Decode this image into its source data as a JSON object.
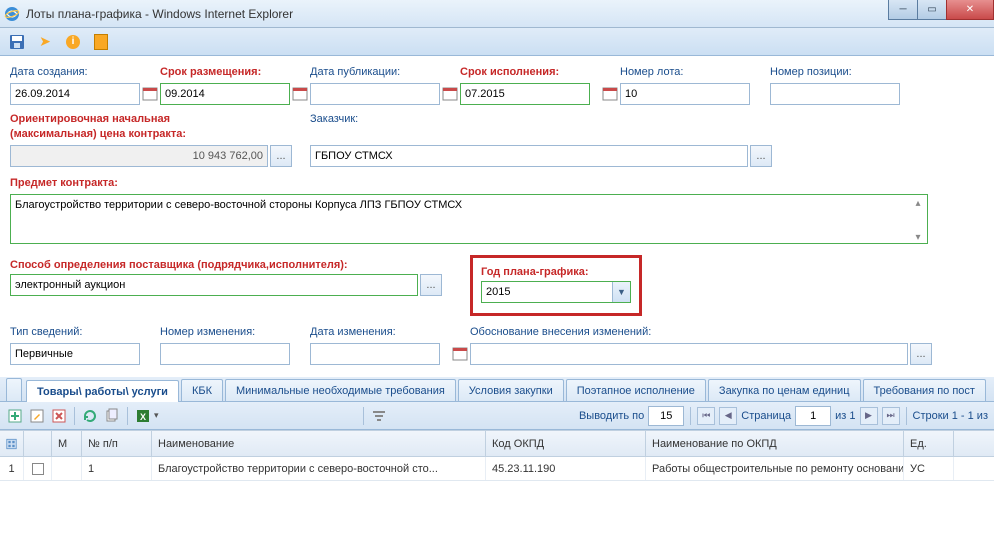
{
  "window": {
    "title": "Лоты плана-графика - Windows Internet Explorer"
  },
  "labels": {
    "createDate": "Дата создания:",
    "placementDate": "Срок размещения:",
    "publishDate": "Дата публикации:",
    "execDate": "Срок исполнения:",
    "lotNumber": "Номер лота:",
    "posNumber": "Номер позиции:",
    "priceLabel1": "Ориентировочная начальная",
    "priceLabel2": "(максимальная) цена контракта:",
    "customer": "Заказчик:",
    "subject": "Предмет контракта:",
    "method": "Способ определения поставщика (подрядчика,исполнителя):",
    "planYear": "Год плана-графика:",
    "infoType": "Тип сведений:",
    "changeNumber": "Номер изменения:",
    "changeDate": "Дата изменения:",
    "changeReason": "Обоснование внесения изменений:"
  },
  "values": {
    "createDate": "26.09.2014",
    "placementDate": "09.2014",
    "publishDate": "",
    "execDate": "07.2015",
    "lotNumber": "10",
    "posNumber": "",
    "price": "10 943 762,00",
    "customer": "ГБПОУ СТМСХ",
    "subject": "Благоустройство территории с северо-восточной стороны Корпуса ЛПЗ ГБПОУ СТМСХ",
    "method": "электронный аукцион",
    "planYear": "2015",
    "infoType": "Первичные",
    "changeNumber": "",
    "changeDate": "",
    "changeReason": ""
  },
  "tabs": [
    "Товары\\ работы\\ услуги",
    "КБК",
    "Минимальные необходимые требования",
    "Условия закупки",
    "Поэтапное исполнение",
    "Закупка по ценам единиц",
    "Требования по пост"
  ],
  "gridToolbar": {
    "perPageLabel": "Выводить по",
    "perPage": "15",
    "pageLabel": "Страница",
    "page": "1",
    "ofLabel": "из 1",
    "rowsLabel": "Строки 1 - 1 из"
  },
  "gridHeaders": {
    "m": "М",
    "np": "№ п/п",
    "name": "Наименование",
    "okpd": "Код ОКПД",
    "okpdName": "Наименование по ОКПД",
    "ed": "Ед."
  },
  "gridRows": [
    {
      "idx": "1",
      "np": "1",
      "name": "Благоустройство территории с северо-восточной сто...",
      "okpd": "45.23.11.190",
      "okpdName": "Работы общестроительные по ремонту оснований пок...",
      "ed": "УС"
    }
  ]
}
